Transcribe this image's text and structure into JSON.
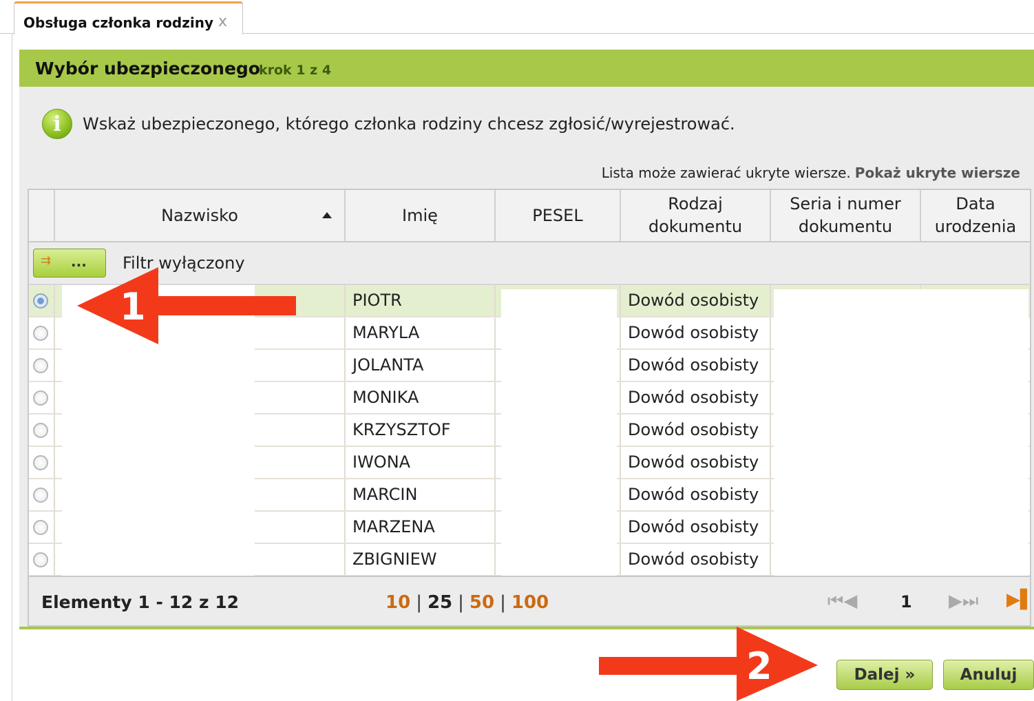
{
  "tab": {
    "label": "Obsługa członka rodziny",
    "close": "x"
  },
  "panel": {
    "title": "Wybór ubezpieczonego",
    "step": "krok 1 z 4"
  },
  "info": {
    "icon": "info-icon",
    "glyph": "i",
    "text": "Wskaż ubezpieczonego, którego członka rodziny chcesz zgłosić/wyrejestrować."
  },
  "hidden_rows": {
    "note": "Lista może zawierać ukryte wiersze.",
    "link": "Pokaż ukryte wiersze"
  },
  "columns": [
    "Nazwisko",
    "Imię",
    "PESEL",
    "Rodzaj dokumentu",
    "Seria i numer dokumentu",
    "Data urodzenia"
  ],
  "filter": {
    "button_dots": "...",
    "label": "Filtr wyłączony"
  },
  "rows": [
    {
      "imie": "PIOTR",
      "rodzaj": "Dowód osobisty",
      "selected": true
    },
    {
      "imie": "MARYLA",
      "rodzaj": "Dowód osobisty",
      "selected": false
    },
    {
      "imie": "JOLANTA",
      "rodzaj": "Dowód osobisty",
      "selected": false
    },
    {
      "imie": "MONIKA",
      "rodzaj": "Dowód osobisty",
      "selected": false
    },
    {
      "imie": "KRZYSZTOF",
      "rodzaj": "Dowód osobisty",
      "selected": false
    },
    {
      "imie": "IWONA",
      "rodzaj": "Dowód osobisty",
      "selected": false
    },
    {
      "imie": "MARCIN",
      "rodzaj": "Dowód osobisty",
      "selected": false
    },
    {
      "imie": "MARZENA",
      "rodzaj": "Dowód osobisty",
      "selected": false
    },
    {
      "imie": "ZBIGNIEW",
      "rodzaj": "Dowód osobisty",
      "selected": false
    }
  ],
  "footer": {
    "count": "Elementy 1 - 12 z 12",
    "page_sizes": [
      "10",
      "25",
      "50",
      "100"
    ],
    "active_page_size": "25",
    "page": "1",
    "first_prev": "⏮◀",
    "next_last": "▶⏭",
    "last_icon": "▶▌"
  },
  "buttons": {
    "next": "Dalej »",
    "cancel": "Anuluj"
  },
  "annotations": {
    "arrow1": "1",
    "arrow2": "2",
    "color": "#f23a1a"
  },
  "colors": {
    "header_green": "#a8c84a",
    "link_orange": "#cc6a10",
    "selected_row": "#e4efcf"
  }
}
